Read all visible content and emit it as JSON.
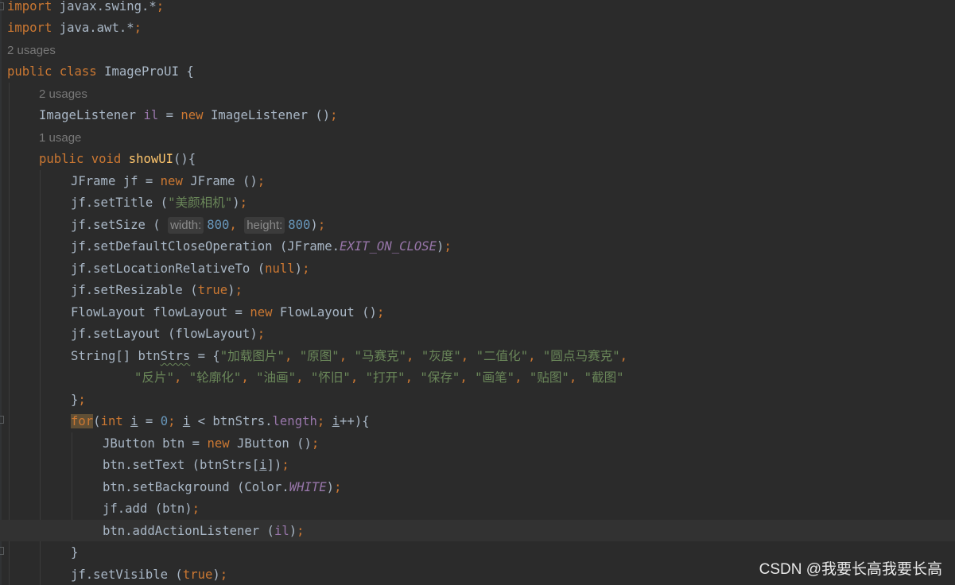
{
  "editor": {
    "language": "Java",
    "lines": {
      "l1": {
        "kw": "import",
        "rest": " javax.swing.*",
        "semi": ";"
      },
      "l2": {
        "kw": "import",
        "rest": " java.awt.*",
        "semi": ";"
      },
      "h3": "2 usages",
      "l4": {
        "kw1": "public",
        "kw2": "class",
        "rest": " ImageProUI {"
      },
      "h5": "2 usages",
      "l6": {
        "type": "ImageListener ",
        "field": "il",
        "eq": " = ",
        "kw": "new",
        "rest": " ImageListener ()",
        "semi": ";"
      },
      "h7": "1 usage",
      "l8": {
        "kw1": "public",
        "kw2": "void",
        "fn": "showUI",
        "rest": "(){"
      },
      "l9": {
        "pre": "JFrame jf = ",
        "kw": "new",
        "rest": " JFrame ()",
        "semi": ";"
      },
      "l10": {
        "pre": "jf.setTitle (",
        "str": "\"美颜相机\"",
        "post": ")",
        "semi": ";"
      },
      "l11": {
        "pre": "jf.setSize ( ",
        "hint1": "width:",
        "num1": "800",
        "comma": ", ",
        "hint2": "height:",
        "num2": "800",
        "post": ")",
        "semi": ";"
      },
      "l12": {
        "pre": "jf.setDefaultCloseOperation (JFrame.",
        "const": "EXIT_ON_CLOSE",
        "post": ")",
        "semi": ";"
      },
      "l13": {
        "pre": "jf.setLocationRelativeTo (",
        "kw": "null",
        "post": ")",
        "semi": ";"
      },
      "l14": {
        "pre": "jf.setResizable (",
        "kw": "true",
        "post": ")",
        "semi": ";"
      },
      "l15": {
        "pre": "FlowLayout flowLayout = ",
        "kw": "new",
        "rest": " FlowLayout ()",
        "semi": ";"
      },
      "l16": {
        "pre": "jf.setLayout (flowLayout)",
        "semi": ";"
      },
      "l17": {
        "pre": "String[] btn",
        "ident": "Strs",
        "eq": " = {",
        "s1": "\"加载图片\"",
        "s2": "\"原图\"",
        "s3": "\"马赛克\"",
        "s4": "\"灰度\"",
        "s5": "\"二值化\"",
        "s6": "\"圆点马赛克\"",
        "sep": ", ",
        "trail": ","
      },
      "l18": {
        "s1": "\"反片\"",
        "s2": "\"轮廓化\"",
        "s3": "\"油画\"",
        "s4": "\"怀旧\"",
        "s5": "\"打开\"",
        "s6": "\"保存\"",
        "s7": "\"画笔\"",
        "s8": "\"贴图\"",
        "s9": "\"截图\"",
        "sep": ", "
      },
      "l19": {
        "pre": "}",
        "semi": ";"
      },
      "l20": {
        "kw": "for",
        "p1": "(",
        "kw2": "int",
        "sp": " ",
        "v1": "i",
        "p2": " = ",
        "num": "0",
        "semi1": ";",
        "sp2": " ",
        "v2": "i",
        "p3": " < btnStrs.",
        "fld": "length",
        "semi2": ";",
        "sp3": " ",
        "v3": "i",
        "p4": "++){"
      },
      "l21": {
        "pre": "JButton btn = ",
        "kw": "new",
        "rest": " JButton ()",
        "semi": ";"
      },
      "l22": {
        "pre": "btn.setText (btnStrs[",
        "v": "i",
        "post": "])",
        "semi": ";"
      },
      "l23": {
        "pre": "btn.setBackground (Color.",
        "const": "WHITE",
        "post": ")",
        "semi": ";"
      },
      "l24": {
        "pre": "jf.add (btn)",
        "semi": ";"
      },
      "l25": {
        "pre": "btn.addActionListener (",
        "fld": "il",
        "post": ")",
        "semi": ";"
      },
      "l26": {
        "pre": "}"
      },
      "l27": {
        "pre": "jf.setVisible (",
        "kw": "true",
        "post": ")",
        "semi": ";"
      }
    }
  },
  "watermark": "CSDN @我要长高我要长高",
  "colors": {
    "background": "#2b2b2b",
    "keyword": "#cc7832",
    "string": "#6a8759",
    "number": "#6897bb",
    "method": "#ffc66d",
    "field": "#9876aa",
    "text": "#a9b7c6",
    "hint": "#787878"
  }
}
